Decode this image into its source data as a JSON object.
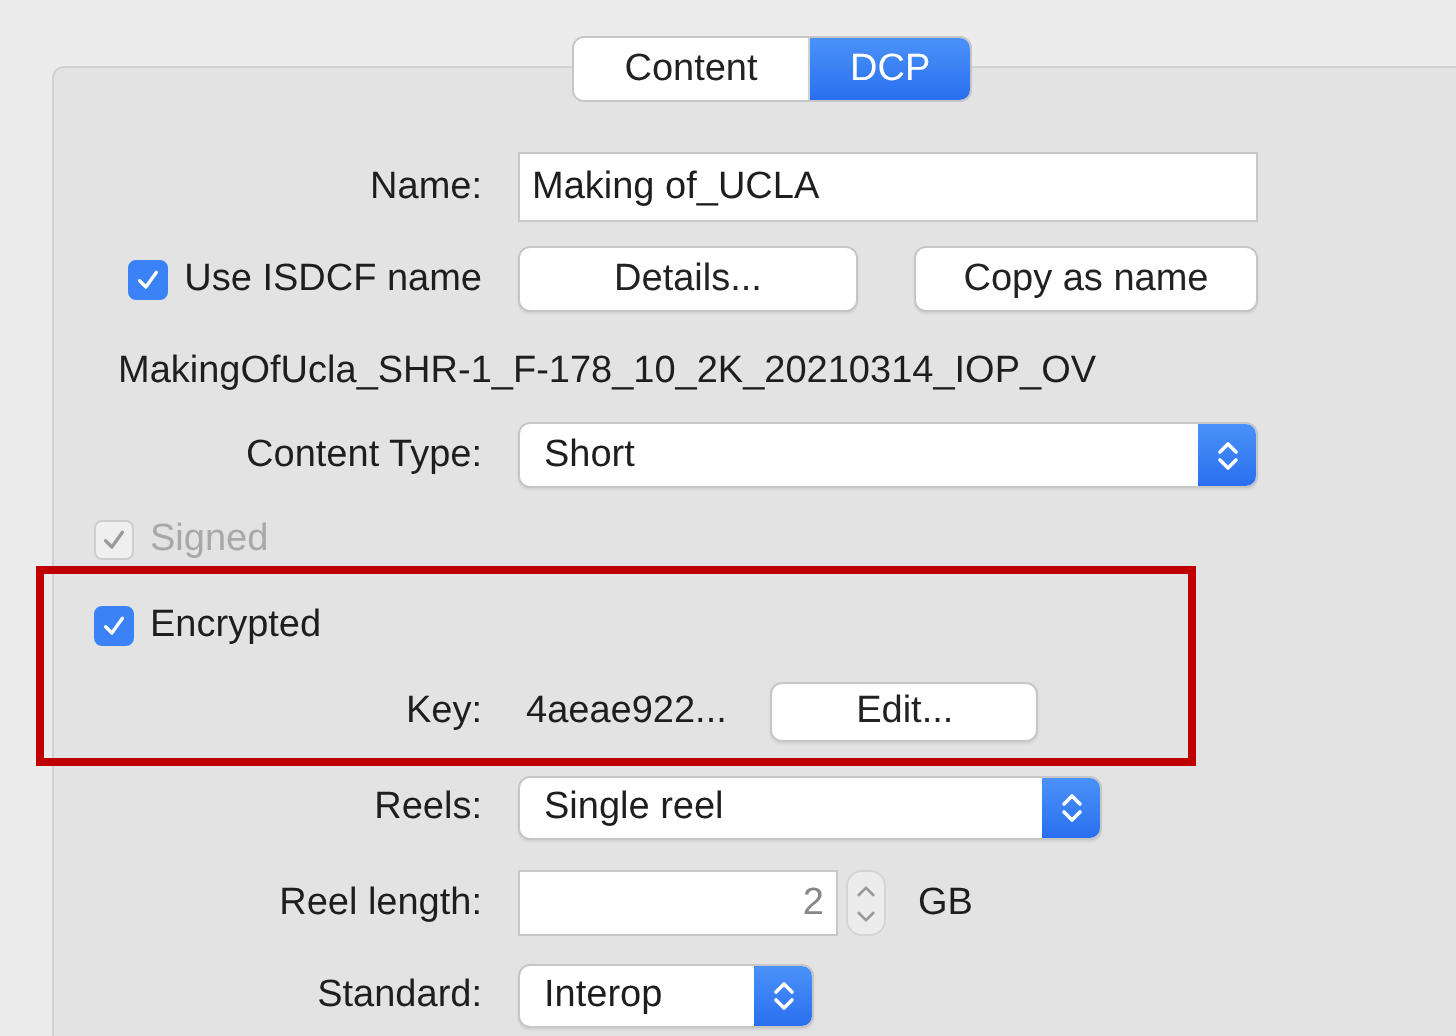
{
  "tabs": [
    {
      "label": "Content",
      "selected": false
    },
    {
      "label": "DCP",
      "selected": true
    }
  ],
  "name": {
    "label": "Name:",
    "value": "Making of_UCLA"
  },
  "use_isdcf": {
    "label": "Use ISDCF name",
    "checked": true,
    "buttons": [
      "Details...",
      "Copy as name"
    ]
  },
  "isdcf_name": "MakingOfUcla_SHR-1_F-178_10_2K_20210314_IOP_OV",
  "content_type": {
    "label": "Content Type:",
    "value": "Short"
  },
  "signed": {
    "label": "Signed",
    "checked": true,
    "disabled": true
  },
  "encrypted": {
    "label": "Encrypted",
    "checked": true,
    "disabled": false
  },
  "key": {
    "label": "Key:",
    "value": "4aeae922...",
    "button": "Edit..."
  },
  "reels": {
    "label": "Reels:",
    "value": "Single reel"
  },
  "reel_length": {
    "label": "Reel length:",
    "value": "2",
    "unit": "GB"
  },
  "standard": {
    "label": "Standard:",
    "value": "Interop"
  }
}
